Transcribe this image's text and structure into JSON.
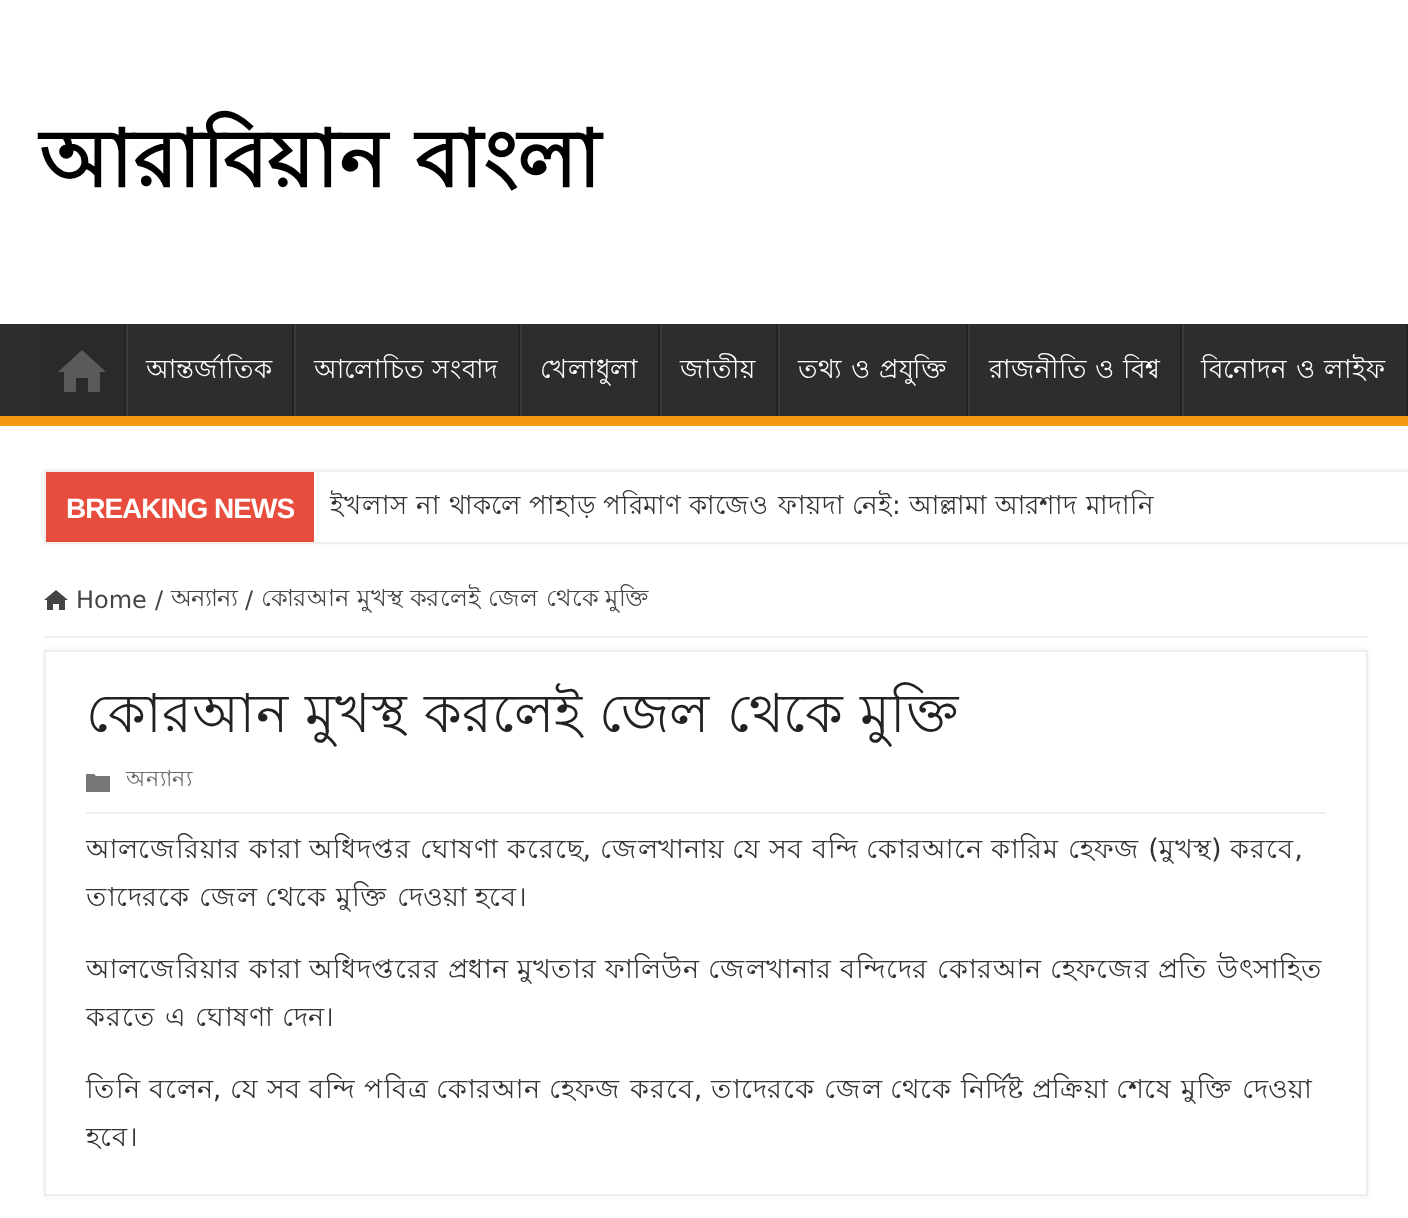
{
  "site": {
    "logo": "আরাবিয়ান বাংলা"
  },
  "nav": {
    "items": [
      {
        "label": "আন্তর্জাতিক"
      },
      {
        "label": "আলোচিত সংবাদ"
      },
      {
        "label": "খেলাধুলা"
      },
      {
        "label": "জাতীয়"
      },
      {
        "label": "তথ্য ও প্রযুক্তি"
      },
      {
        "label": "রাজনীতি ও বিশ্ব"
      },
      {
        "label": "বিনোদন ও লাইফ"
      }
    ]
  },
  "breaking": {
    "label": "BREAKING NEWS",
    "headline": "ইখলাস না থাকলে পাহাড় পরিমাণ কাজেও ফায়দা নেই: আল্লামা আরশাদ মাদানি"
  },
  "breadcrumb_separator": "/",
  "breadcrumb": [
    "Home",
    "অন্যান্য",
    "কোরআন মুখস্থ করলেই জেল থেকে মুক্তি"
  ],
  "article": {
    "title": "কোরআন মুখস্থ করলেই জেল থেকে মুক্তি",
    "category": "অন্যান্য",
    "paragraphs": [
      "আলজেরিয়ার কারা অধিদপ্তর ঘোষণা করেছে, জেলখানায় যে সব বন্দি কোরআনে কারিম হেফজ (মুখস্থ) করবে, তাদেরকে জেল থেকে মুক্তি দেওয়া হবে।",
      "আলজেরিয়ার কারা অধিদপ্তরের প্রধান মুখতার ফালিউন জেলখানার বন্দিদের কোরআন হেফজের প্রতি উৎসাহিত করতে এ ঘোষণা দেন।",
      "তিনি বলেন, যে সব বন্দি পবিত্র কোরআন হেফজ করবে, তাদেরকে জেল থেকে নির্দিষ্ট প্রক্রিয়া শেষে মুক্তি দেওয়া হবে।"
    ]
  }
}
